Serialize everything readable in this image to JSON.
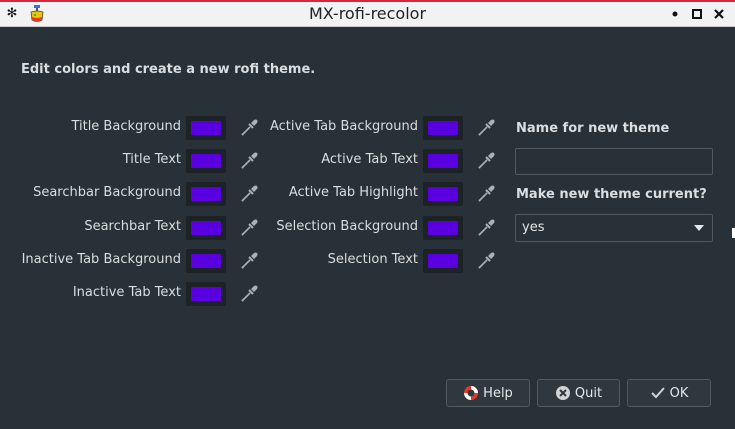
{
  "window": {
    "title": "MX-rofi-recolor"
  },
  "heading": "Edit colors and create a new rofi theme.",
  "swatch_color": "#5a00e0",
  "left_colors": [
    {
      "label": "Title Background"
    },
    {
      "label": "Title Text"
    },
    {
      "label": "Searchbar Background"
    },
    {
      "label": "Searchbar Text"
    },
    {
      "label": "Inactive Tab Background"
    },
    {
      "label": "Inactive Tab Text"
    }
  ],
  "middle_colors": [
    {
      "label": "Active Tab Background"
    },
    {
      "label": "Active Tab Text"
    },
    {
      "label": "Active Tab Highlight"
    },
    {
      "label": "Selection Background"
    },
    {
      "label": "Selection Text"
    }
  ],
  "theme_name": {
    "label": "Name for new theme",
    "value": ""
  },
  "make_current": {
    "label": "Make new theme current?",
    "value": "yes"
  },
  "buttons": {
    "help": "Help",
    "quit": "Quit",
    "ok": "OK"
  }
}
